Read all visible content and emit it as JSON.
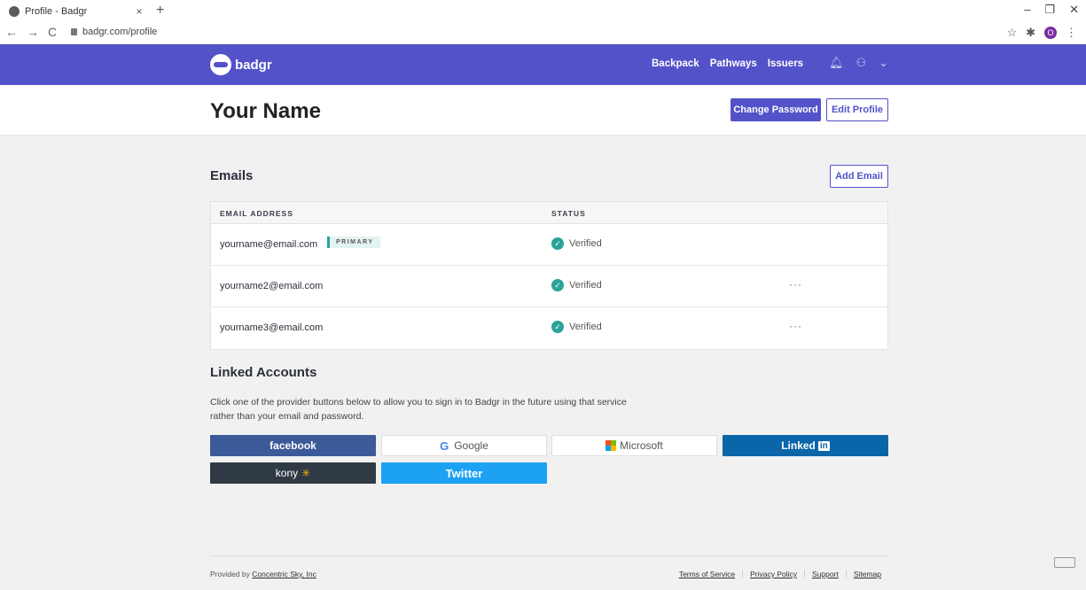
{
  "browser": {
    "tab_title": "Profile - Badgr",
    "tab_close": "×",
    "new_tab": "+",
    "url": "badgr.com/profile",
    "window_controls": [
      "–",
      "❐",
      "✕"
    ],
    "nav": [
      "←",
      "→",
      "C"
    ],
    "profile_initial": "O"
  },
  "header": {
    "brand": "badgr",
    "nav": [
      "Backpack",
      "Pathways",
      "Issuers"
    ]
  },
  "profile": {
    "name": "Your Name",
    "change_password_label": "Change Password",
    "edit_profile_label": "Edit Profile"
  },
  "emails": {
    "title": "Emails",
    "add_label": "Add Email",
    "columns": [
      "EMAIL ADDRESS",
      "STATUS"
    ],
    "rows": [
      {
        "address": "yourname@email.com",
        "badge": "PRIMARY",
        "status": "Verified",
        "more": ""
      },
      {
        "address": "yourname2@email.com",
        "badge": "",
        "status": "Verified",
        "more": "···"
      },
      {
        "address": "yourname3@email.com",
        "badge": "",
        "status": "Verified",
        "more": "···"
      }
    ]
  },
  "linked": {
    "title": "Linked Accounts",
    "description": "Click one of the provider buttons below to allow you to sign in to Badgr in the future using that service rather than your email and password.",
    "providers": {
      "facebook": "facebook",
      "google": "Google",
      "microsoft": "Microsoft",
      "linkedin": "Linked",
      "linkedin_mark": "in",
      "kony": "kony",
      "twitter": "Twitter"
    }
  },
  "footer": {
    "provided_by": "Provided by",
    "company": "Concentric Sky, Inc",
    "links": [
      "Terms of Service",
      "Privacy Policy",
      "Support",
      "Sitemap"
    ]
  },
  "colors": {
    "brand": "#5352c9",
    "verified": "#2aa398",
    "facebook": "#3c5a99",
    "linkedin": "#0a66a8",
    "kony": "#2f3a44",
    "twitter": "#1da1f2"
  }
}
